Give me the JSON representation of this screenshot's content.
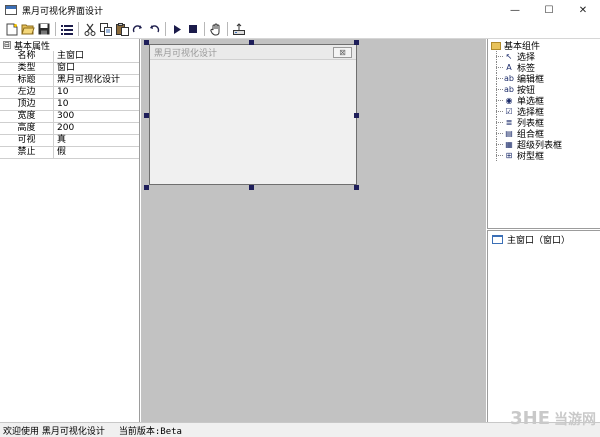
{
  "window": {
    "title": "黑月可视化界面设计",
    "minimize": "—",
    "maximize": "☐",
    "close": "✕"
  },
  "toolbar": {
    "buttons": [
      "new-file",
      "open-folder",
      "save",
      "list",
      "cut",
      "copy",
      "paste",
      "redo",
      "undo",
      "run",
      "stop",
      "hand",
      "export"
    ]
  },
  "properties": {
    "group_label": "基本属性",
    "expander": "⊟",
    "rows": [
      {
        "key": "名称",
        "value": "主窗口"
      },
      {
        "key": "类型",
        "value": "窗口"
      },
      {
        "key": "标题",
        "value": "黑月可视化设计"
      },
      {
        "key": "左边",
        "value": "10"
      },
      {
        "key": "顶边",
        "value": "10"
      },
      {
        "key": "宽度",
        "value": "300"
      },
      {
        "key": "高度",
        "value": "200"
      },
      {
        "key": "可视",
        "value": "真"
      },
      {
        "key": "禁止",
        "value": "假"
      }
    ]
  },
  "designer": {
    "caption": "黑月可视化设计",
    "close": "⊠"
  },
  "toolbox": {
    "root_label": "基本组件",
    "items": [
      {
        "label": "选择",
        "icon": "arrow-cursor-icon",
        "glyph": "↖"
      },
      {
        "label": "标签",
        "icon": "label-a-icon",
        "glyph": "A"
      },
      {
        "label": "编辑框",
        "icon": "editbox-icon",
        "glyph": "ab"
      },
      {
        "label": "按钮",
        "icon": "button-icon",
        "glyph": "ab"
      },
      {
        "label": "单选框",
        "icon": "radio-icon",
        "glyph": "◉"
      },
      {
        "label": "选择框",
        "icon": "checkbox-icon",
        "glyph": "☑"
      },
      {
        "label": "列表框",
        "icon": "listbox-icon",
        "glyph": "≣"
      },
      {
        "label": "组合框",
        "icon": "combobox-icon",
        "glyph": "▤"
      },
      {
        "label": "超级列表框",
        "icon": "listview-icon",
        "glyph": "▦"
      },
      {
        "label": "树型框",
        "icon": "treeview-icon",
        "glyph": "⊞"
      }
    ]
  },
  "object_tree": {
    "items": [
      {
        "label": "主窗口（窗口）"
      }
    ]
  },
  "status": {
    "welcome": "欢迎使用 黑月可视化设计",
    "version": "当前版本:Beta"
  },
  "watermark": {
    "logo": "3HE",
    "text": "当游网"
  }
}
